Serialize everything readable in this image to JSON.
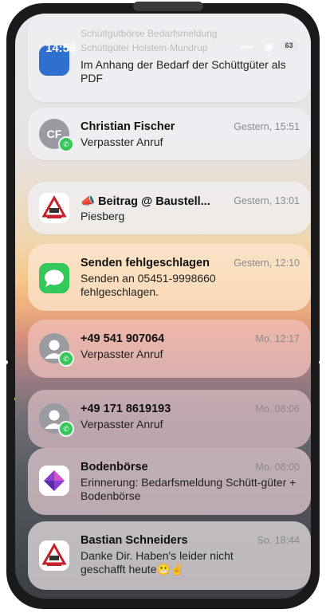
{
  "status_bar": {
    "time": "14:59",
    "signal": "••••",
    "wifi": "◉",
    "battery": "63"
  },
  "notifications": [
    {
      "faded_title": "Schüttgutbörse Bedarfsmeldung",
      "faded_subtitle": "Schüttgüter Holstein-Mundrup",
      "body": "Im Anhang der Bedarf der Schüttgüter als PDF"
    },
    {
      "title": "Christian Fischer",
      "time": "Gestern, 15:51",
      "body": "Verpasster Anruf",
      "avatar_initials": "CF"
    },
    {
      "title": "📣 Beitrag @ Baustell...",
      "time": "Gestern, 13:01",
      "body": "Piesberg"
    },
    {
      "title": "Senden fehlgeschlagen",
      "time": "Gestern, 12:10",
      "body": "Senden an 05451-9998660 fehlgeschlagen."
    },
    {
      "title": "+49 541 907064",
      "time": "Mo. 12:17",
      "body": "Verpasster Anruf"
    },
    {
      "title": "+49 171 8619193",
      "time": "Mo. 08:06",
      "body": "Verpasster Anruf"
    },
    {
      "title": "Bodenbörse",
      "time": "Mo. 08:00",
      "body": "Erinnerung: Bedarfsmeldung Schütt-güter + Bodenbörse"
    },
    {
      "title": "Bastian Schneiders",
      "time": "So. 18:44",
      "body": "Danke Dir. Haben's leider nicht geschafft heute😬✌️"
    }
  ],
  "colors": {
    "messages_green": "#34c759",
    "call_badge": "#34c759",
    "bodenboerse_purple": "#8b3fd1"
  }
}
